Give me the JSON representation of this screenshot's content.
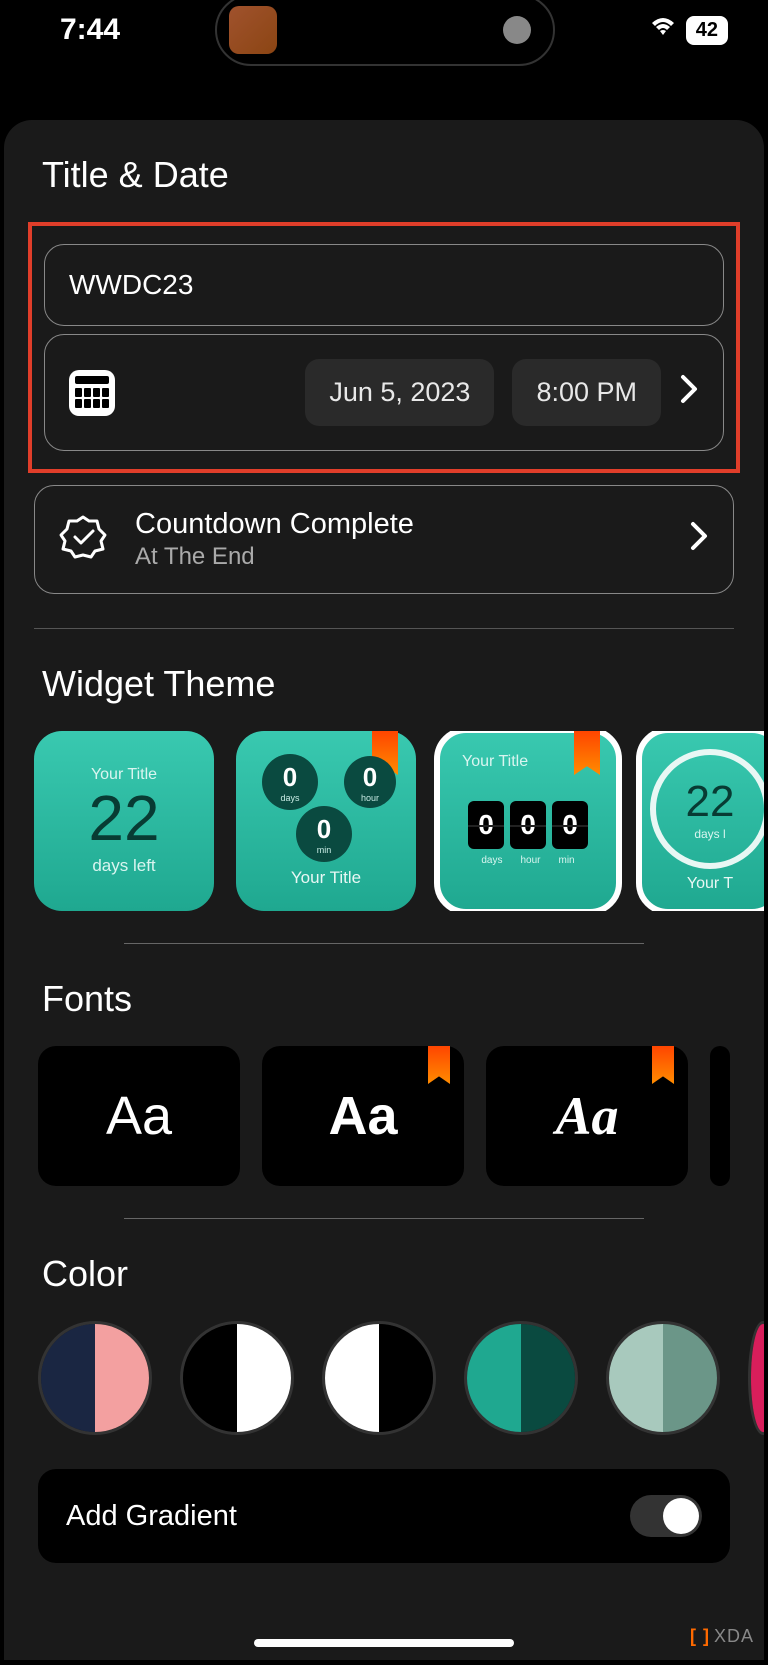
{
  "status": {
    "time": "7:44",
    "battery": "42"
  },
  "sections": {
    "titleDate": "Title & Date",
    "widgetTheme": "Widget Theme",
    "fonts": "Fonts",
    "color": "Color"
  },
  "inputs": {
    "title_value": "WWDC23"
  },
  "date_row": {
    "date": "Jun 5, 2023",
    "time": "8:00 PM"
  },
  "complete_row": {
    "title": "Countdown Complete",
    "subtitle": "At The End"
  },
  "themes": [
    {
      "title": "Your Title",
      "number": "22",
      "sub": "days left",
      "ribbon": false
    },
    {
      "title": "Your Title",
      "d": "0",
      "h": "0",
      "m": "0",
      "dl": "days",
      "hl": "hour",
      "ml": "min",
      "ribbon": true
    },
    {
      "title": "Your Title",
      "digits": [
        "0",
        "0",
        "0"
      ],
      "labels": [
        "days",
        "hour",
        "min"
      ],
      "ribbon": true,
      "selected": true
    },
    {
      "title": "Your T",
      "number": "22",
      "sub": "days l",
      "ribbon": false
    }
  ],
  "fontsList": [
    {
      "sample": "Aa",
      "ribbon": false,
      "italic": false
    },
    {
      "sample": "Aa",
      "ribbon": true,
      "italic": false
    },
    {
      "sample": "Aa",
      "ribbon": true,
      "italic": true
    }
  ],
  "colors": [
    {
      "left": "#1a2642",
      "right": "#f3a0a0"
    },
    {
      "left": "#000000",
      "right": "#ffffff"
    },
    {
      "left": "#ffffff",
      "right": "#000000"
    },
    {
      "left": "#1fa890",
      "right": "#0a4a40"
    },
    {
      "left": "#a8c9bd",
      "right": "#6b9688"
    },
    {
      "left": "#d91e5b",
      "right": "#d91e5b"
    }
  ],
  "gradient": {
    "label": "Add Gradient",
    "on": true
  },
  "watermark": {
    "text": "XDA"
  }
}
